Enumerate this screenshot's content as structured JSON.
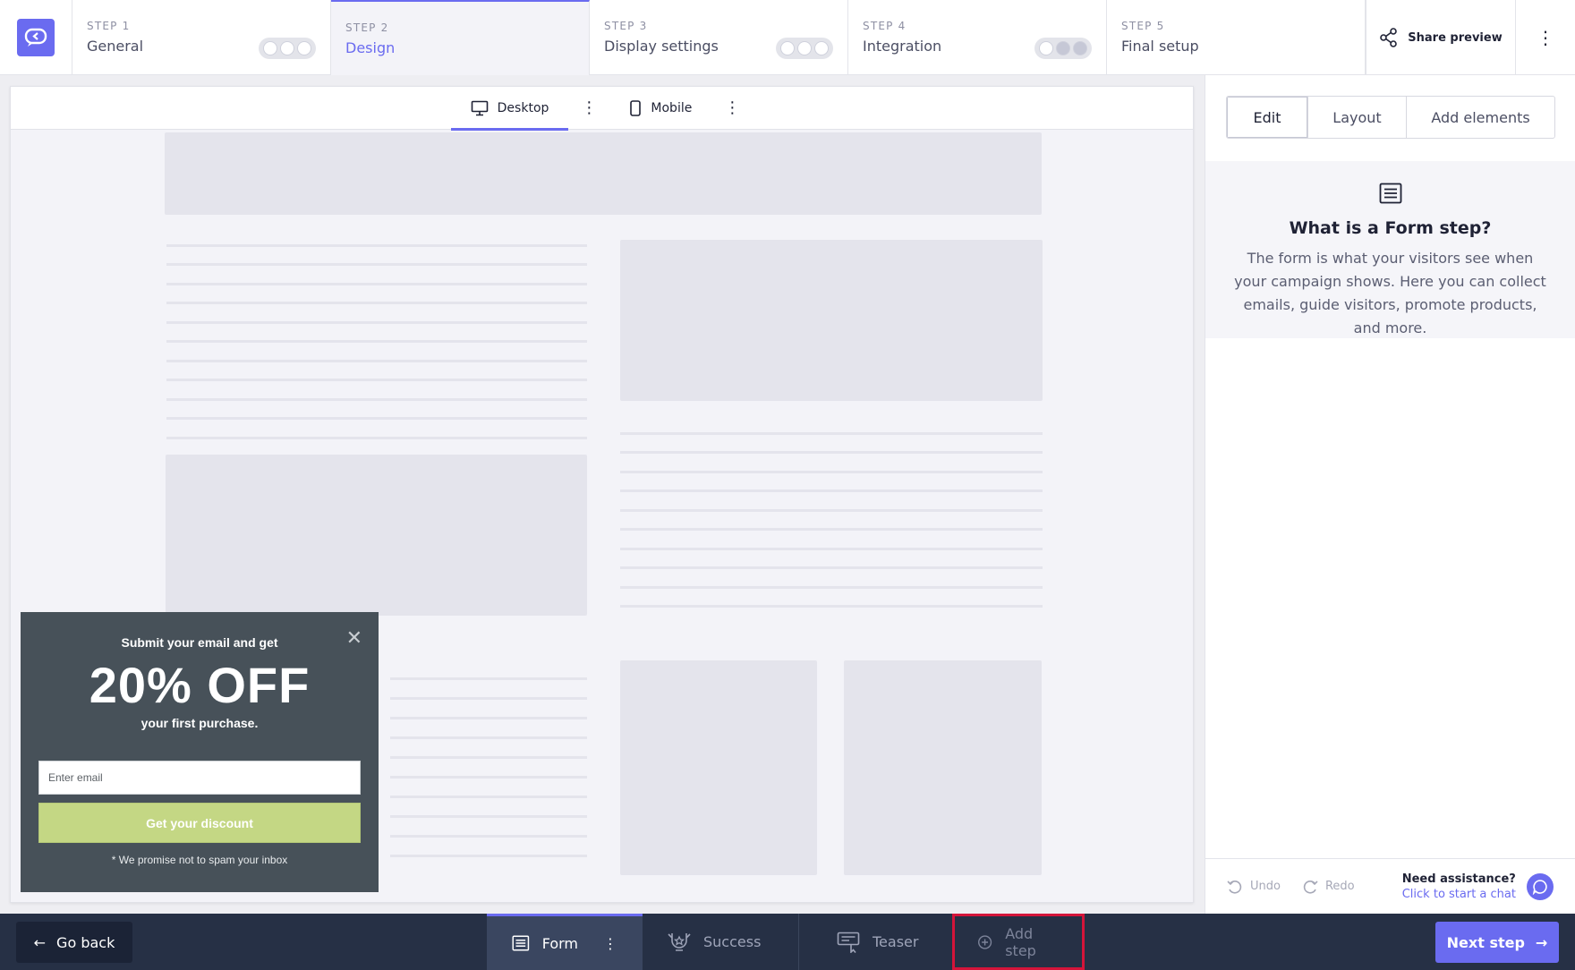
{
  "steps": [
    {
      "num": "STEP 1",
      "name": "General",
      "dots": [
        false,
        false,
        false
      ]
    },
    {
      "num": "STEP 2",
      "name": "Design"
    },
    {
      "num": "STEP 3",
      "name": "Display settings",
      "dots": [
        false,
        false,
        false
      ]
    },
    {
      "num": "STEP 4",
      "name": "Integration",
      "dots": [
        false,
        true,
        true
      ]
    },
    {
      "num": "STEP 5",
      "name": "Final setup"
    }
  ],
  "header": {
    "share_label": "Share preview"
  },
  "device_tabs": {
    "desktop": "Desktop",
    "mobile": "Mobile"
  },
  "popup": {
    "headline": "Submit your email and get",
    "offer": "20% OFF",
    "subline": "your first purchase.",
    "email_placeholder": "Enter email",
    "button": "Get your discount",
    "note": "* We promise not to spam your inbox"
  },
  "right_panel": {
    "tabs": [
      "Edit",
      "Layout",
      "Add elements"
    ],
    "info_title": "What is a Form step?",
    "info_text": "The form is what your visitors see when your campaign shows. Here you can collect emails, guide visitors, promote products, and more.",
    "undo": "Undo",
    "redo": "Redo",
    "assist_question": "Need assistance?",
    "assist_link": "Click to start a chat"
  },
  "bottom": {
    "go_back": "Go back",
    "tabs": {
      "form": "Form",
      "success": "Success",
      "teaser": "Teaser",
      "add_step": "Add step"
    },
    "next_step": "Next step"
  },
  "colors": {
    "accent": "#6a6bf0",
    "popup_bg": "#475159",
    "popup_button": "#c4d784",
    "highlight": "#d4143a"
  }
}
